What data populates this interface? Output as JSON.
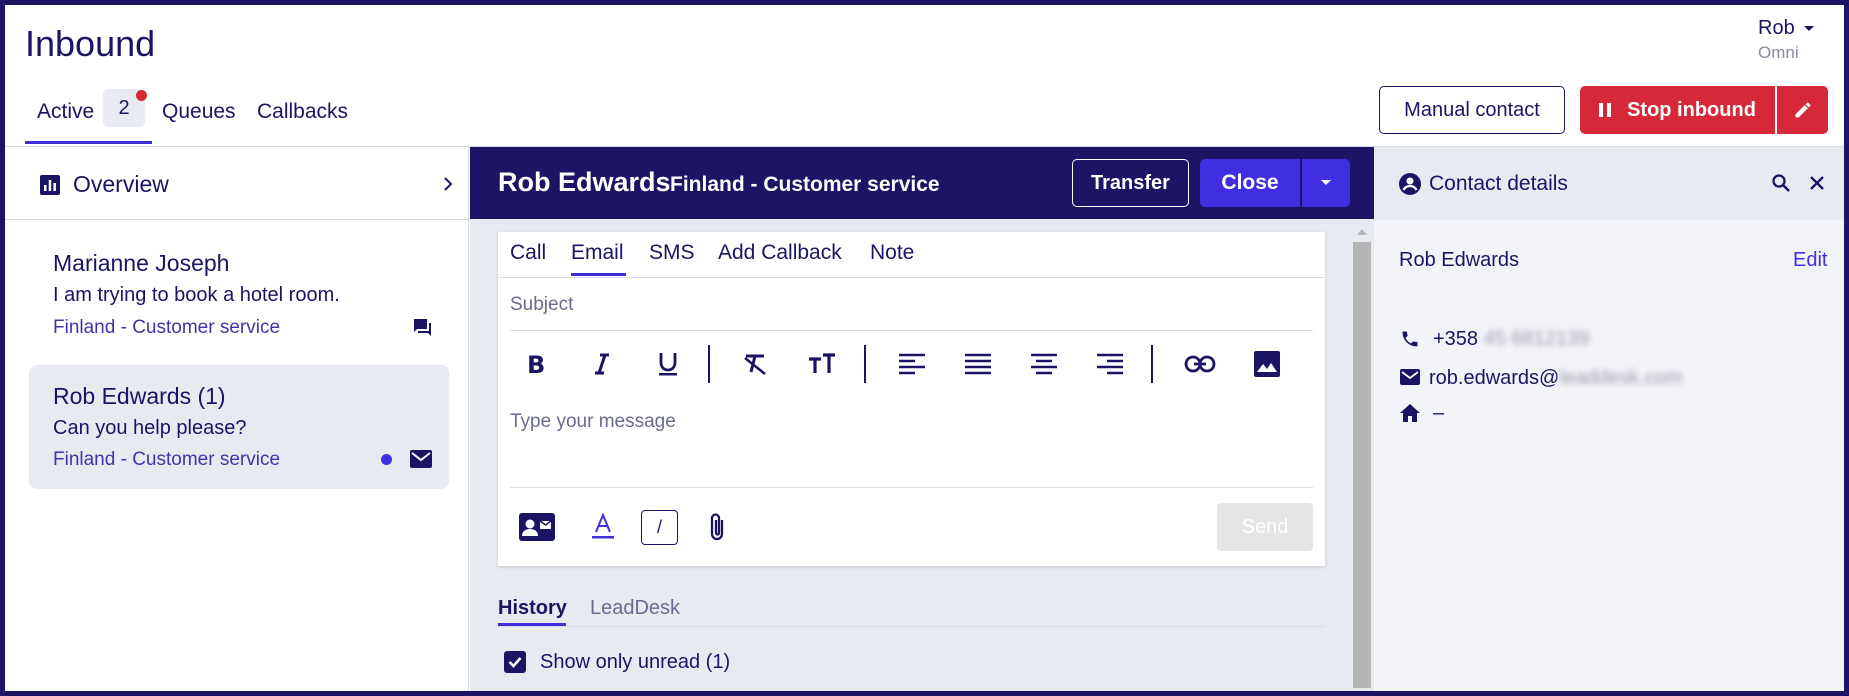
{
  "header": {
    "title": "Inbound",
    "user_name": "Rob",
    "user_role": "Omni",
    "tabs": [
      {
        "label": "Active",
        "badge": "2"
      },
      {
        "label": "Queues"
      },
      {
        "label": "Callbacks"
      }
    ],
    "manual_contact_label": "Manual contact",
    "stop_inbound_label": "Stop inbound",
    "accent_color": "#3f2fe0",
    "danger_color": "#d62839"
  },
  "sidebar": {
    "overview_label": "Overview",
    "conversations": [
      {
        "name": "Marianne Joseph",
        "message": "I am trying to book a hotel room.",
        "queue": "Finland - Customer service",
        "channel_icon": "chat-icon"
      },
      {
        "name": "Rob Edwards (1)",
        "message": "Can you help please?",
        "queue": "Finland - Customer service",
        "channel_icon": "mail-icon",
        "unread": true
      }
    ]
  },
  "contact": {
    "name": "Rob Edwards",
    "queue": "Finland - Customer service",
    "transfer_label": "Transfer",
    "close_label": "Close"
  },
  "composer": {
    "tabs": [
      "Call",
      "Email",
      "SMS",
      "Add Callback",
      "Note"
    ],
    "active_tab": "Email",
    "subject_placeholder": "Subject",
    "message_placeholder": "Type your message",
    "send_label": "Send",
    "signature_label": "/"
  },
  "history": {
    "tabs": [
      "History",
      "LeadDesk"
    ],
    "show_unread_label": "Show only unread (1)",
    "show_unread_checked": true
  },
  "details": {
    "title": "Contact details",
    "name": "Rob Edwards",
    "edit_label": "Edit",
    "phone_prefix": "+358",
    "phone_rest": "45 6812139",
    "email_prefix": "rob.edwards@",
    "email_rest": "leaddesk.com",
    "address": "–"
  }
}
